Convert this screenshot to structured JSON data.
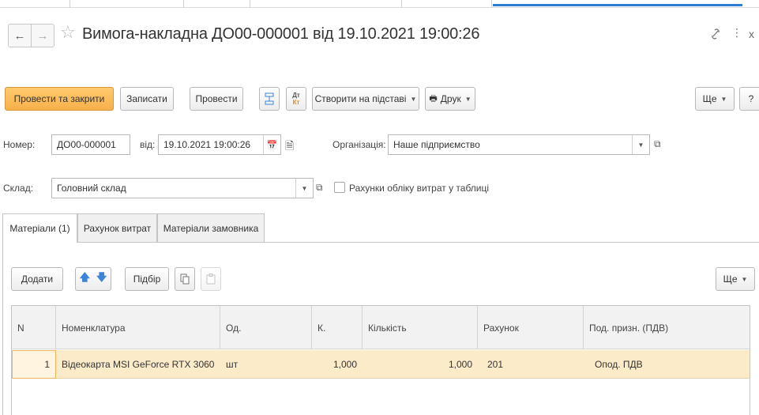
{
  "header": {
    "back_icon": "arrow-left-icon",
    "forward_icon": "arrow-right-icon",
    "favorite_icon": "star-icon",
    "title": "Вимога-накладна ДО00-000001 від 19.10.2021 19:00:26",
    "link_icon": "link-icon",
    "more_icon": "kebab-icon",
    "close_label": "x"
  },
  "toolbar": {
    "post_close": "Провести та закрити",
    "save": "Записати",
    "post": "Провести",
    "structure_icon": "structure-icon",
    "dtkt_icon_top": "Дт",
    "dtkt_icon_bottom": "Кт",
    "create_based": "Створити на підставі",
    "print": "Друк",
    "more": "Ще",
    "help": "?"
  },
  "form": {
    "number_label": "Номер:",
    "number_value": "ДО00-000001",
    "date_label": "від:",
    "date_value": "19.10.2021 19:00:26",
    "org_label": "Організація:",
    "org_value": "Наше підприємство",
    "warehouse_label": "Склад:",
    "warehouse_value": "Головний склад",
    "expense_accounts_label": "Рахунки обліку витрат у таблиці",
    "expense_accounts_checked": false
  },
  "tabs": [
    {
      "label": "Матеріали (1)",
      "active": true
    },
    {
      "label": "Рахунок витрат",
      "active": false
    },
    {
      "label": "Матеріали замовника",
      "active": false
    }
  ],
  "table_toolbar": {
    "add": "Додати",
    "up_icon": "arrow-up-icon",
    "down_icon": "arrow-down-icon",
    "pick": "Підбір",
    "copy_icon": "copy-icon",
    "paste_icon": "paste-icon",
    "more": "Ще"
  },
  "table": {
    "columns": [
      "N",
      "Номенклатура",
      "Од.",
      "К.",
      "Кількість",
      "Рахунок",
      "Под. призн. (ПДВ)"
    ],
    "rows": [
      {
        "n": "1",
        "item": "Відеокарта MSI GeForce RTX 3060",
        "unit": "шт",
        "k": "1,000",
        "qty": "1,000",
        "account": "201",
        "vat": "Опод. ПДВ"
      }
    ]
  },
  "colors": {
    "primary_button": "#f7b04a",
    "selected_row": "#fcebc9",
    "active_tab_line": "#2d7dd2",
    "arrow_blue": "#3d84d8"
  }
}
